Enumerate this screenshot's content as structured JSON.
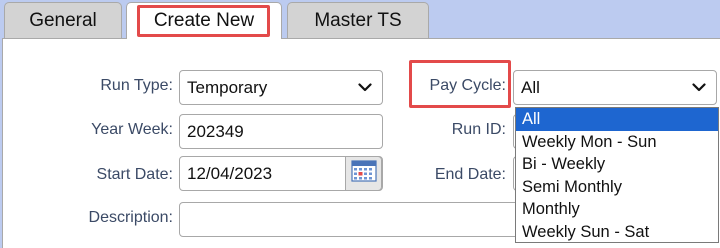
{
  "tabs": [
    {
      "label": "General"
    },
    {
      "label": "Create New",
      "active": true
    },
    {
      "label": "Master TS"
    }
  ],
  "form": {
    "run_type": {
      "label": "Run Type:",
      "value": "Temporary"
    },
    "pay_cycle": {
      "label": "Pay Cycle:",
      "value": "All",
      "options": [
        "All",
        "Weekly Mon - Sun",
        "Bi - Weekly",
        "Semi Monthly",
        "Monthly",
        "Weekly Sun - Sat"
      ]
    },
    "year_week": {
      "label": "Year Week:",
      "value": "202349"
    },
    "run_id": {
      "label": "Run ID:",
      "value": ""
    },
    "start_date": {
      "label": "Start Date:",
      "value": "12/04/2023"
    },
    "end_date": {
      "label": "End Date:",
      "value": ""
    },
    "description": {
      "label": "Description:",
      "value": ""
    }
  },
  "icons": {
    "dropdown": "chevron-down-icon",
    "calendar": "calendar-icon"
  },
  "colors": {
    "highlight": "#e34a4a",
    "selected_option": "#1e66d0",
    "page_background": "#bccbf0"
  }
}
